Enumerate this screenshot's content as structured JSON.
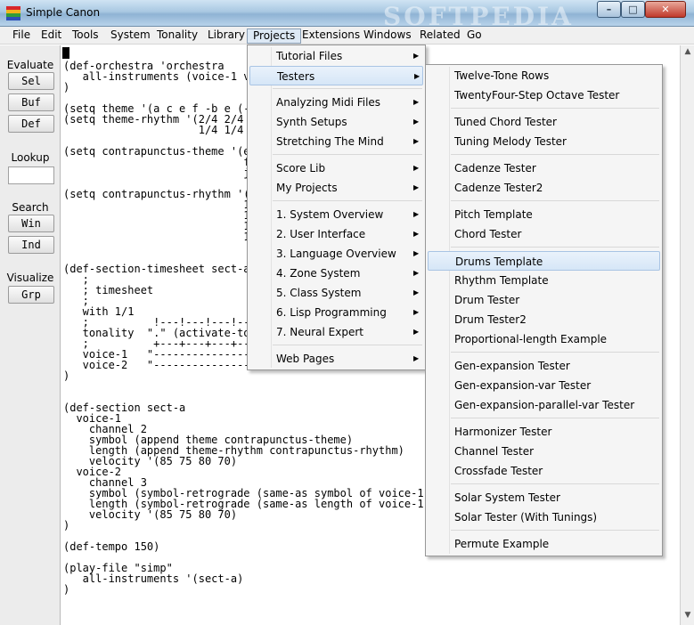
{
  "window": {
    "title": "Simple Canon",
    "watermark": "SOFTPEDIA",
    "minimize_label": "–",
    "maximize_label": "□",
    "close_label": "✕"
  },
  "menubar": [
    "File",
    "Edit",
    "Tools",
    "System",
    "Tonality",
    "Library",
    "Projects",
    "Extensions",
    "Windows",
    "Related",
    "Go"
  ],
  "leftpanel": {
    "evaluate_label": "Evaluate",
    "sel": "Sel",
    "buf": "Buf",
    "def": "Def",
    "lookup_label": "Lookup",
    "lookup_value": "",
    "search_label": "Search",
    "win": "Win",
    "ind": "Ind",
    "visualize_label": "Visualize",
    "grp": "Grp"
  },
  "code_lines": [
    "",
    "(def-orchestra 'orchestra",
    "   all-instruments (voice-1 vo",
    ")",
    "",
    "(setq theme '(a c e f -b e (-",
    "(setq theme-rhythm '(2/4 2/4 2",
    "                     1/4 1/4 1",
    "",
    "(setq contrapunctus-theme '(e",
    "                            f",
    "                            j",
    "",
    "(setq contrapunctus-rhythm '(",
    "                            1",
    "                            1",
    "                            1",
    "                            1",
    "",
    "",
    "(def-section-timesheet sect-a",
    "   ;",
    "   ; timesheet",
    "   ;",
    "   with 1/1",
    "   ;          !---!---!---!---",
    "   tonality  \".\" (activate-ton",
    "   ;          +---+---+---+---",
    "   voice-1   \"-----------------",
    "   voice-2   \"-----------------",
    ")",
    "",
    "",
    "(def-section sect-a",
    "  voice-1",
    "    channel 2",
    "    symbol (append theme contrapunctus-theme)",
    "    length (append theme-rhythm contrapunctus-rhythm)",
    "    velocity '(85 75 80 70)",
    "  voice-2",
    "    channel 3",
    "    symbol (symbol-retrograde (same-as symbol of voice-1))",
    "    length (symbol-retrograde (same-as length of voice-1))",
    "    velocity '(85 75 80 70)",
    ")",
    "",
    "(def-tempo 150)",
    "",
    "(play-file \"simp\"",
    "   all-instruments '(sect-a)",
    ")"
  ],
  "projects_menu": {
    "groups": [
      [
        {
          "label": "Tutorial Files",
          "submenu": true
        },
        {
          "label": "Testers",
          "submenu": true,
          "highlighted": true
        }
      ],
      [
        {
          "label": "Analyzing Midi Files",
          "submenu": true
        },
        {
          "label": "Synth Setups",
          "submenu": true
        },
        {
          "label": "Stretching The Mind",
          "submenu": true
        }
      ],
      [
        {
          "label": "Score Lib",
          "submenu": true
        },
        {
          "label": "My Projects",
          "submenu": true
        }
      ],
      [
        {
          "label": "1. System Overview",
          "submenu": true
        },
        {
          "label": "2. User Interface",
          "submenu": true
        },
        {
          "label": "3. Language Overview",
          "submenu": true
        },
        {
          "label": "4. Zone System",
          "submenu": true
        },
        {
          "label": "5. Class System",
          "submenu": true
        },
        {
          "label": "6. Lisp Programming",
          "submenu": true
        },
        {
          "label": "7. Neural Expert",
          "submenu": true
        }
      ],
      [
        {
          "label": "Web Pages",
          "submenu": true
        }
      ]
    ]
  },
  "testers_menu": {
    "groups": [
      [
        "Twelve-Tone Rows",
        "TwentyFour-Step Octave Tester"
      ],
      [
        "Tuned Chord Tester",
        "Tuning Melody Tester"
      ],
      [
        "Cadenze Tester",
        "Cadenze Tester2"
      ],
      [
        "Pitch Template",
        "Chord Tester"
      ],
      [
        "Drums Template",
        "Rhythm Template",
        "Drum Tester",
        "Drum Tester2",
        "Proportional-length Example"
      ],
      [
        "Gen-expansion Tester",
        "Gen-expansion-var Tester",
        "Gen-expansion-parallel-var Tester"
      ],
      [
        "Harmonizer Tester",
        "Channel Tester",
        "Crossfade Tester"
      ],
      [
        "Solar System Tester",
        "Solar Tester (With Tunings)"
      ],
      [
        "Permute Example"
      ]
    ],
    "highlighted": "Drums Template"
  }
}
